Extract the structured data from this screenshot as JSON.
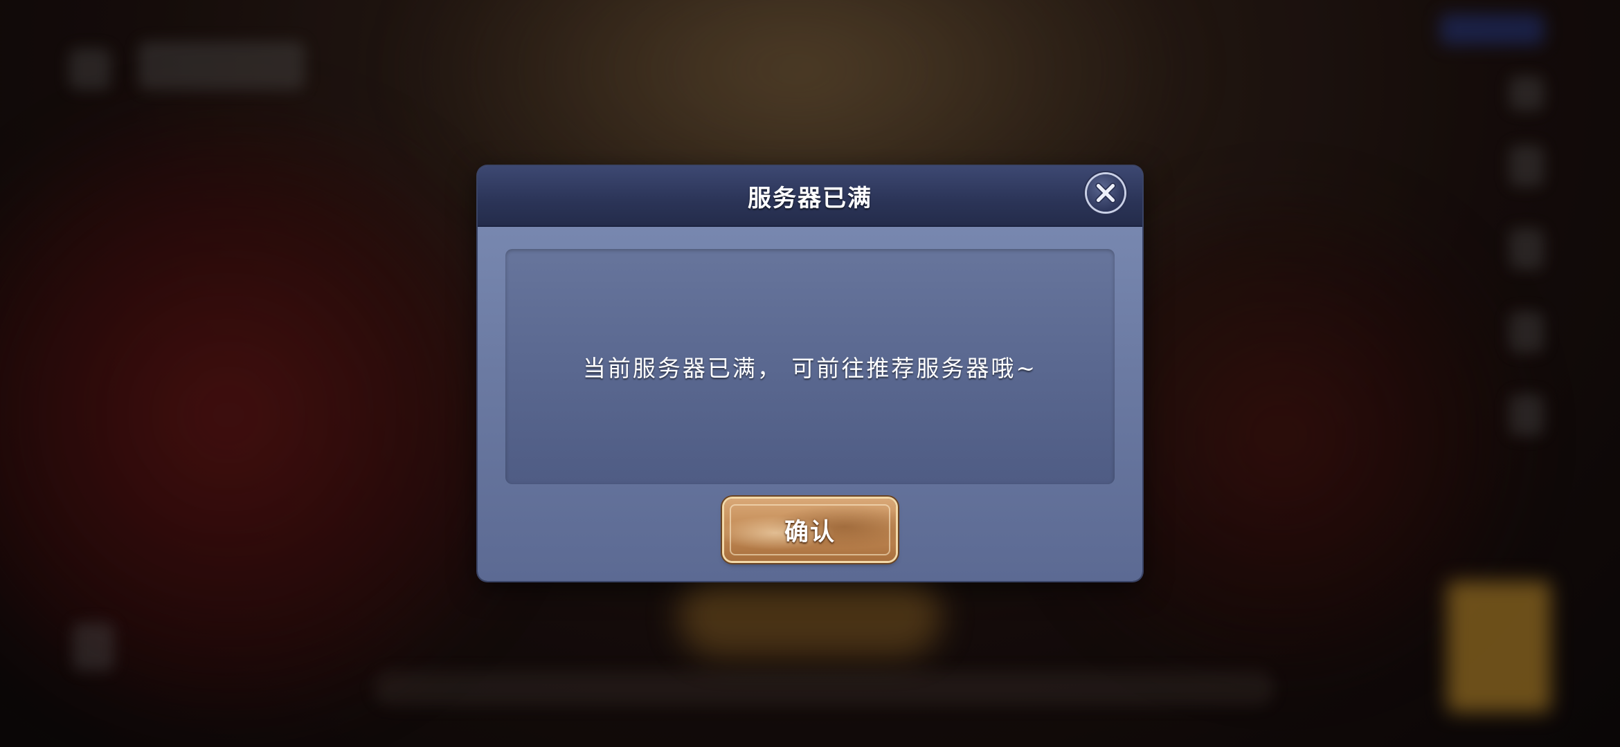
{
  "dialog": {
    "title": "服务器已满",
    "message": "当前服务器已满， 可前往推荐服务器哦~",
    "confirm_label": "确认",
    "close_icon": "close-x-icon"
  },
  "colors": {
    "header": "#2b3457",
    "body": "#6b7aa2",
    "panel": "#5a6890",
    "confirm_button": "#c28a55"
  }
}
